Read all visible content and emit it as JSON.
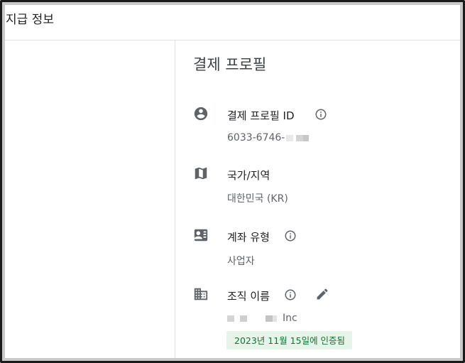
{
  "header": {
    "title": "지급 정보"
  },
  "profile": {
    "section_title": "결제 프로필",
    "rows": [
      {
        "icon": "account-circle-icon",
        "label": "결제 프로필 ID",
        "value": "6033-6746-"
      },
      {
        "icon": "map-icon",
        "label": "국가/지역",
        "value": "대한민국 (KR)"
      },
      {
        "icon": "contact-card-icon",
        "label": "계좌 유형",
        "value": "사업자"
      },
      {
        "icon": "business-icon",
        "label": "조직 이름",
        "value_suffix": "Inc",
        "badge": "2023년 11월 15일에 인증됨"
      }
    ]
  },
  "colors": {
    "badge_bg": "#e6f4ea",
    "badge_text": "#137333",
    "icon": "#5f6368"
  }
}
